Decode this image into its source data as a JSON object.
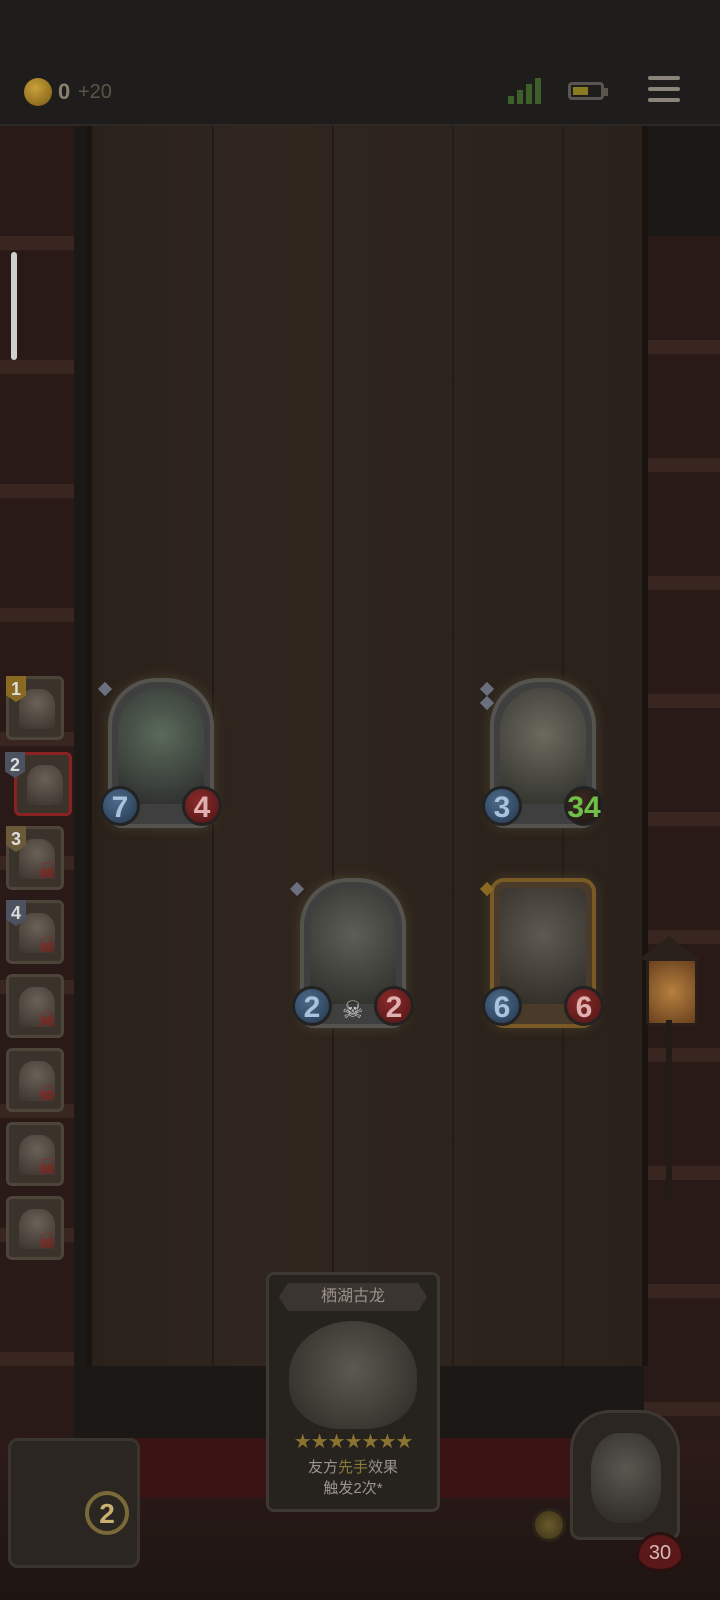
{
  "status": {
    "coins": "0",
    "coin_bonus": "+20"
  },
  "queue": [
    {
      "num": "1",
      "state": "current"
    },
    {
      "num": "2",
      "state": "active"
    },
    {
      "num": "3",
      "state": "defeated"
    },
    {
      "num": "4",
      "state": "defeated"
    },
    {
      "num": "",
      "state": "defeated"
    },
    {
      "num": "",
      "state": "defeated"
    },
    {
      "num": "",
      "state": "defeated"
    },
    {
      "num": "",
      "state": "defeated"
    }
  ],
  "board": {
    "cards": [
      {
        "name": "demon-girl",
        "attack": "7",
        "health": "4"
      },
      {
        "name": "lake-dragon",
        "attack": "3",
        "health": "34"
      },
      {
        "name": "robot-tower",
        "attack": "2",
        "health": "2"
      },
      {
        "name": "missile-card",
        "attack": "6",
        "health": "6"
      }
    ]
  },
  "hand_card": {
    "title": "栖湖古龙",
    "stars": "★★★★★★★",
    "desc_prefix": "友方",
    "desc_highlight": "先手",
    "desc_suffix": "效果",
    "desc_line2": "触发2次*"
  },
  "deck": {
    "count": "2"
  },
  "hero": {
    "health": "30"
  },
  "icons": {
    "skull": "☠"
  },
  "colors": {
    "buffed_health": "#6fbf4a",
    "attack": "#24384e",
    "health": "#4e1414"
  }
}
